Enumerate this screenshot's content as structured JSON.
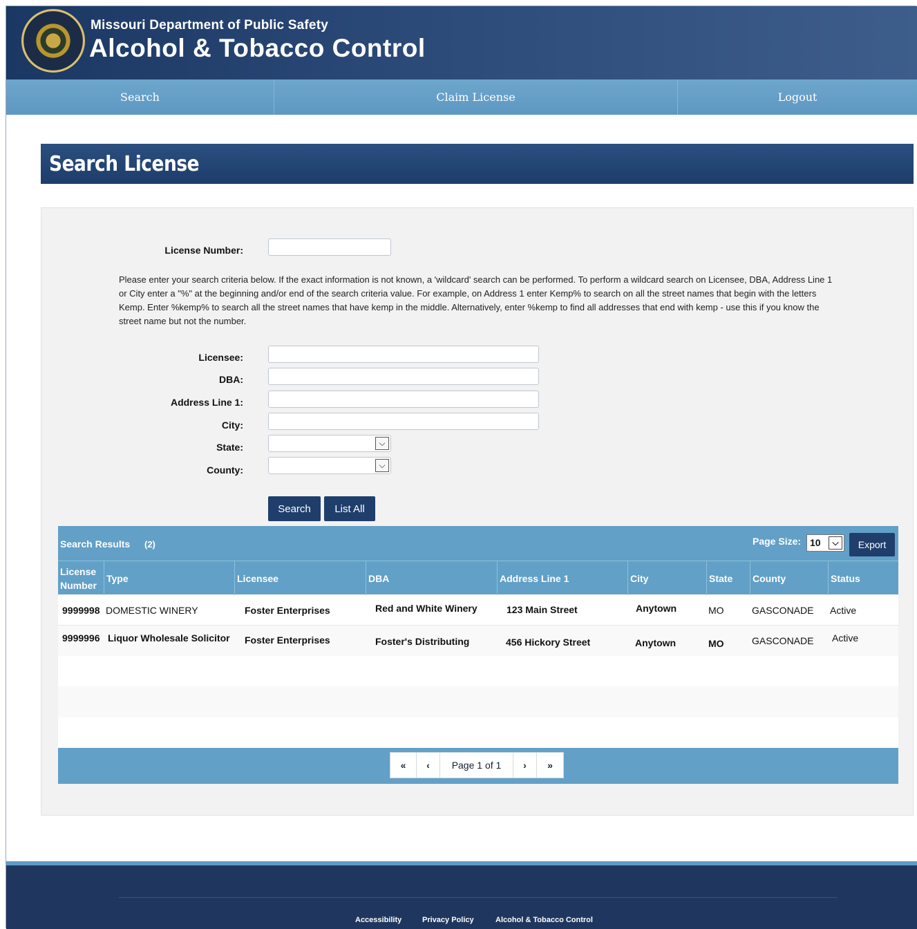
{
  "header": {
    "org": "Missouri Department of Public Safety",
    "title": "Alcohol & Tobacco Control"
  },
  "nav": {
    "items": [
      "Search",
      "Claim License",
      "Logout"
    ]
  },
  "page": {
    "title": "Search License"
  },
  "form": {
    "license_number_label": "License Number:",
    "instructions": "Please enter your search criteria below. If the exact information is not known, a 'wildcard' search can be performed. To perform a wildcard search on Licensee, DBA, Address Line 1 or City enter a \"%\" at the beginning and/or end of the search criteria value. For example, on Address 1 enter Kemp% to search on all the street names that begin with the letters Kemp. Enter %kemp% to search all the street names that have kemp in the middle. Alternatively, enter %kemp to find all addresses that end with kemp - use this if you know the street name but not the number.",
    "licensee_label": "Licensee:",
    "dba_label": "DBA:",
    "address_label": "Address Line 1:",
    "city_label": "City:",
    "state_label": "State:",
    "county_label": "County:",
    "license_number_value": "",
    "licensee_value": "",
    "dba_value": "",
    "address_value": "",
    "city_value": "",
    "state_value": "",
    "county_value": "",
    "search_button": "Search",
    "list_all_button": "List All"
  },
  "results": {
    "title": "Search Results",
    "count": "(2)",
    "page_size_label": "Page Size:",
    "page_size_value": "10",
    "export_button": "Export",
    "columns": [
      "License Number",
      "Type",
      "Licensee",
      "DBA",
      "Address Line 1",
      "City",
      "State",
      "County",
      "Status"
    ],
    "rows": [
      [
        "9999998",
        "DOMESTIC WINERY",
        "Foster Enterprises",
        "Red and White Winery",
        "123 Main Street",
        "Anytown",
        "MO",
        "GASCONADE",
        "Active"
      ],
      [
        "9999996",
        "Liquor Wholesale Solicitor",
        "Foster Enterprises",
        "Foster's Distributing",
        "456 Hickory Street",
        "Anytown",
        "MO",
        "GASCONADE",
        "Active"
      ]
    ],
    "pager": {
      "first": "«",
      "prev": "‹",
      "label": "Page 1 of 1",
      "next": "›",
      "last": "»"
    }
  },
  "footer": {
    "links": [
      "Accessibility",
      "Privacy Policy",
      "Alcohol & Tobacco Control"
    ]
  }
}
